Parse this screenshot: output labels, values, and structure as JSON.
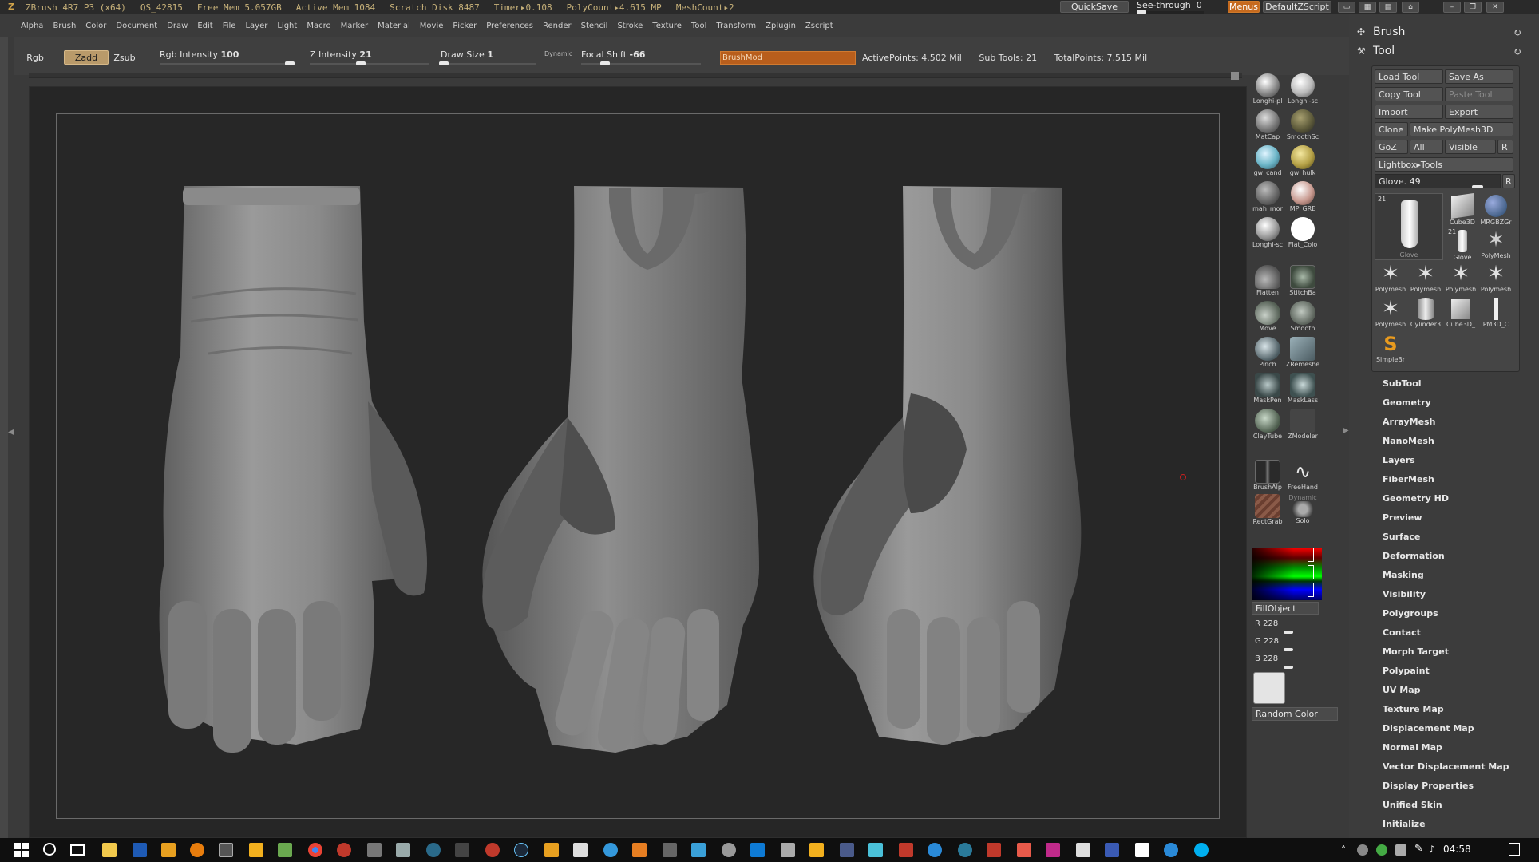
{
  "titlebar": {
    "app": "ZBrush 4R7 P3 (x64)",
    "project": "QS_42815",
    "free_mem": "Free Mem 5.057GB",
    "active_mem": "Active Mem 1084",
    "scratch_disk": "Scratch Disk 8487",
    "timer": "Timer▸0.108",
    "polycount": "PolyCount▸4.615 MP",
    "meshcount": "MeshCount▸2",
    "quicksave": "QuickSave",
    "see_through_label": "See-through",
    "see_through_value": "0",
    "see_through_level": 0,
    "menus": "Menus",
    "default_zscript": "DefaultZScript"
  },
  "menubar": [
    "Alpha",
    "Brush",
    "Color",
    "Document",
    "Draw",
    "Edit",
    "File",
    "Layer",
    "Light",
    "Macro",
    "Marker",
    "Material",
    "Movie",
    "Picker",
    "Preferences",
    "Render",
    "Stencil",
    "Stroke",
    "Texture",
    "Tool",
    "Transform",
    "Zplugin",
    "Zscript"
  ],
  "topshelf": {
    "rgb": "Rgb",
    "zadd": "Zadd",
    "zsub": "Zsub",
    "rgb_intensity_label": "Rgb Intensity",
    "rgb_intensity_value": "100",
    "z_intensity_label": "Z Intensity",
    "z_intensity_value": "21",
    "draw_size_label": "Draw Size",
    "draw_size_value": "1",
    "dynamic": "Dynamic",
    "focal_shift_label": "Focal Shift",
    "focal_shift_value": "-66",
    "brushmod": "BrushMod",
    "active_points": "ActivePoints: 4.502 Mil",
    "sub_tools": "Sub Tools: 21",
    "total_points": "TotalPoints: 7.515 Mil"
  },
  "palette": {
    "materials": [
      {
        "label": "Longhi-pl",
        "color": "#8a8a8a"
      },
      {
        "label": "Longhi-sc",
        "color": "#b8b8b8"
      },
      {
        "label": "MatCap",
        "color": "#7a7a7a"
      },
      {
        "label": "SmoothSc",
        "color": "#5d5a3a"
      },
      {
        "label": "gw_cand",
        "color": "#6ab4c6"
      },
      {
        "label": "gw_hulk",
        "color": "#b4a046"
      },
      {
        "label": "mah_mor",
        "color": "#6a6a6a"
      },
      {
        "label": "MP_GRE",
        "color": "#c89a90"
      },
      {
        "label": "Longhi-sc",
        "color": "#9a9a9a"
      },
      {
        "label": "Flat_Colo",
        "color": "#ffffff"
      }
    ],
    "brushes": [
      {
        "label": "Flatten",
        "icon": "flatten-brush-icon"
      },
      {
        "label": "StitchBa",
        "icon": "stitch-brush-icon"
      },
      {
        "label": "Move",
        "icon": "move-brush-icon"
      },
      {
        "label": "Smooth",
        "icon": "smooth-brush-icon"
      },
      {
        "label": "Pinch",
        "icon": "pinch-brush-icon"
      },
      {
        "label": "ZRemeshe",
        "icon": "zremesher-brush-icon"
      },
      {
        "label": "MaskPen",
        "icon": "maskpen-brush-icon"
      },
      {
        "label": "MaskLass",
        "icon": "masklasso-brush-icon"
      },
      {
        "label": "ClayTube",
        "icon": "claytube-brush-icon"
      },
      {
        "label": "ZModeler",
        "icon": "zmodeler-brush-icon"
      }
    ],
    "strokes": [
      {
        "label": "BrushAlp",
        "icon": "alpha-icon"
      },
      {
        "label": "FreeHand",
        "icon": "freehand-stroke-icon"
      },
      {
        "label": "RectGrab",
        "icon": "texture-icon"
      },
      {
        "label": "Solo",
        "icon": "solo-icon"
      }
    ],
    "dynamic_small": "Dynamic",
    "fill_object": "FillObject",
    "r_label": "R 228",
    "g_label": "G 228",
    "b_label": "B 228",
    "random_color": "Random Color",
    "swatch_color": "#e4e4e4"
  },
  "right_panel": {
    "brush_title": "Brush",
    "tool_title": "Tool",
    "buttons": {
      "load_tool": "Load Tool",
      "save_as": "Save As",
      "copy_tool": "Copy Tool",
      "paste_tool": "Paste Tool",
      "import": "Import",
      "export": "Export",
      "clone": "Clone",
      "make_polymesh": "Make PolyMesh3D",
      "goz": "GoZ",
      "all": "All",
      "visible": "Visible",
      "r": "R",
      "lightbox_tools": "Lightbox▸Tools",
      "glove_slider": "Glove. 49",
      "r2": "R"
    },
    "thumbs": [
      {
        "label": "Glove",
        "badge": "21"
      },
      {
        "label": "Cube3D",
        "badge": ""
      },
      {
        "label": "MRGBZGr",
        "badge": ""
      },
      {
        "label": "Glove",
        "badge": "21"
      },
      {
        "label": "PolyMesh",
        "badge": ""
      },
      {
        "label": "Polymesh",
        "badge": ""
      },
      {
        "label": "Polymesh",
        "badge": ""
      },
      {
        "label": "Polymesh",
        "badge": ""
      },
      {
        "label": "Polymesh",
        "badge": ""
      },
      {
        "label": "Polymesh",
        "badge": ""
      },
      {
        "label": "Cylinder3",
        "badge": ""
      },
      {
        "label": "Cube3D_",
        "badge": ""
      },
      {
        "label": "PM3D_C",
        "badge": ""
      },
      {
        "label": "SimpleBr",
        "badge": ""
      }
    ],
    "subpalettes": [
      "SubTool",
      "Geometry",
      "ArrayMesh",
      "NanoMesh",
      "Layers",
      "FiberMesh",
      "Geometry HD",
      "Preview",
      "Surface",
      "Deformation",
      "Masking",
      "Visibility",
      "Polygroups",
      "Contact",
      "Morph Target",
      "Polypaint",
      "UV Map",
      "Texture Map",
      "Displacement Map",
      "Normal Map",
      "Vector Displacement Map",
      "Display Properties",
      "Unified Skin",
      "Initialize"
    ]
  },
  "taskbar": {
    "clock": "04:58",
    "icons": [
      "windows-start-icon",
      "search-icon",
      "task-view-icon",
      "file-explorer-icon",
      "photoshop-icon",
      "media-player-icon",
      "blender-icon",
      "zbrush-icon",
      "marmoset-icon",
      "game-icon",
      "chrome-icon",
      "davinci-icon",
      "app-icon",
      "app-icon",
      "app-icon",
      "app-icon",
      "app-icon",
      "steam-icon",
      "app-icon",
      "app-icon",
      "app-icon",
      "app-icon",
      "app-icon",
      "app-icon",
      "vscode-icon",
      "app-icon",
      "marmoset-icon",
      "app-icon",
      "app-icon",
      "app-icon",
      "app-icon",
      "app-icon",
      "app-icon",
      "app-icon",
      "app-icon",
      "app-icon",
      "app-icon",
      "app-icon",
      "app-icon",
      "skype-icon"
    ]
  }
}
